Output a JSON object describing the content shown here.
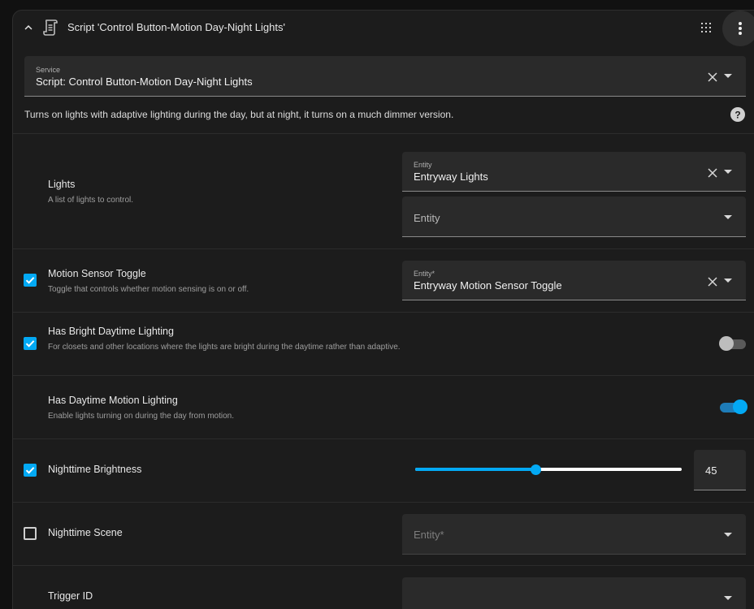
{
  "header": {
    "title": "Script 'Control Button-Motion Day-Night Lights'"
  },
  "service": {
    "label": "Service",
    "value": "Script: Control Button-Motion Day-Night Lights"
  },
  "description": "Turns on lights with adaptive lighting during the day, but at night, it turns on a much dimmer version.",
  "rows": {
    "lights": {
      "title": "Lights",
      "subtitle": "A list of lights to control.",
      "entity_label": "Entity",
      "entity_value": "Entryway Lights",
      "empty_placeholder": "Entity"
    },
    "motion_toggle": {
      "checked": true,
      "title": "Motion Sensor Toggle",
      "subtitle": "Toggle that controls whether motion sensing is on or off.",
      "entity_label": "Entity*",
      "entity_value": "Entryway Motion Sensor Toggle"
    },
    "bright_daytime": {
      "checked": true,
      "title": "Has Bright Daytime Lighting",
      "subtitle": "For closets and other locations where the lights are bright during the daytime rather than adaptive.",
      "switch_on": false
    },
    "daytime_motion": {
      "title": "Has Daytime Motion Lighting",
      "subtitle": "Enable lights turning on during the day from motion.",
      "switch_on": true
    },
    "night_brightness": {
      "checked": true,
      "title": "Nighttime Brightness",
      "value": "45",
      "slider_fraction": 0.45
    },
    "night_scene": {
      "checked": false,
      "title": "Nighttime Scene",
      "placeholder": "Entity*"
    },
    "trigger_id": {
      "title": "Trigger ID"
    }
  },
  "colors": {
    "accent": "#03a9f4",
    "card": "#1c1c1c",
    "field": "#2a2a2a"
  },
  "icons": {
    "collapse": "chevron-up-icon",
    "script": "script-scroll-icon",
    "drag": "drag-grid-icon",
    "menu": "dots-vertical-icon",
    "help": "help-circle-icon",
    "clear": "close-icon",
    "dropdown": "menu-down-icon"
  }
}
